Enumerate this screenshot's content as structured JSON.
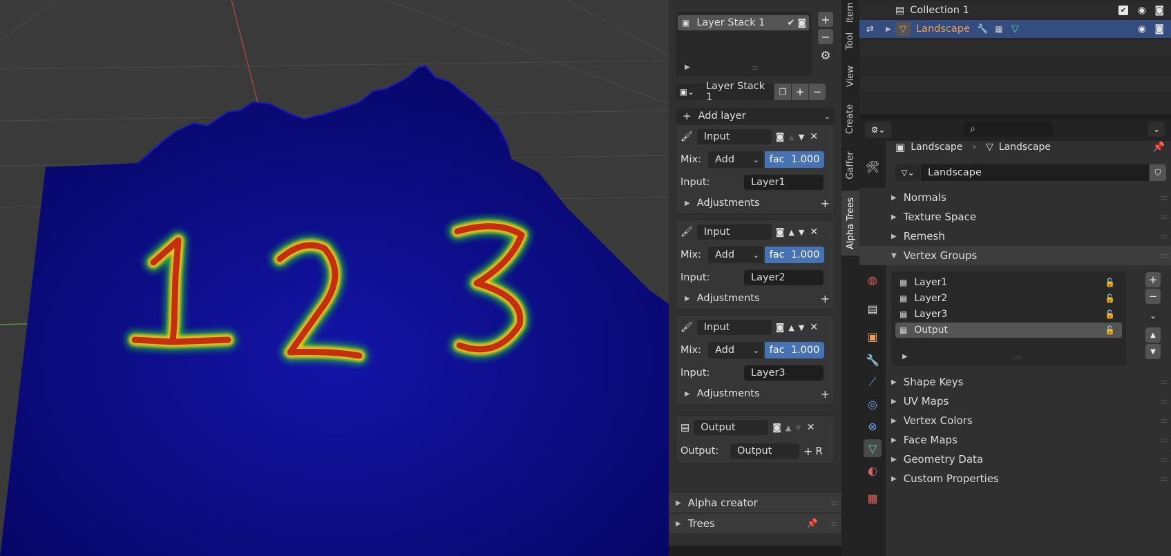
{
  "viewport": {
    "numbers": [
      "1",
      "2",
      "3"
    ]
  },
  "layer_panel": {
    "stack_list_item": "Layer Stack 1",
    "stack_selector": "Layer Stack 1",
    "add_layer": "Add layer",
    "layers": [
      {
        "name": "Input",
        "mix_label": "Mix:",
        "mix": "Add",
        "fac_label": "fac",
        "fac": "1.000",
        "input_label": "Input:",
        "input": "Layer1",
        "adjustments": "Adjustments"
      },
      {
        "name": "Input",
        "mix_label": "Mix:",
        "mix": "Add",
        "fac_label": "fac",
        "fac": "1.000",
        "input_label": "Input:",
        "input": "Layer2",
        "adjustments": "Adjustments"
      },
      {
        "name": "Input",
        "mix_label": "Mix:",
        "mix": "Add",
        "fac_label": "fac",
        "fac": "1.000",
        "input_label": "Input:",
        "input": "Layer3",
        "adjustments": "Adjustments"
      }
    ],
    "output": {
      "name": "Output",
      "label": "Output:",
      "value": "Output",
      "reset": "R"
    },
    "alpha_creator": "Alpha creator",
    "trees": "Trees"
  },
  "sidebar_tabs": [
    "Item",
    "Tool",
    "View",
    "Create",
    "Gaffer",
    "Alpha Trees"
  ],
  "outliner": {
    "collection": "Collection 1",
    "object": "Landscape"
  },
  "properties": {
    "breadcrumb_object": "Landscape",
    "breadcrumb_data": "Landscape",
    "mesh_name": "Landscape",
    "sections_before": [
      "Normals",
      "Texture Space",
      "Remesh",
      "Vertex Groups"
    ],
    "vertex_groups": [
      "Layer1",
      "Layer2",
      "Layer3",
      "Output"
    ],
    "sections_after": [
      "Shape Keys",
      "UV Maps",
      "Vertex Colors",
      "Face Maps",
      "Geometry Data",
      "Custom Properties"
    ]
  },
  "colors": {
    "terrain": "#0a0f8a",
    "heat_red": "#c42a12",
    "heat_yellow": "#e8c81a",
    "heat_green": "#28c23c",
    "accent_blue": "#4772b3",
    "selection": "#334d80",
    "object_orange": "#e8a25c"
  }
}
